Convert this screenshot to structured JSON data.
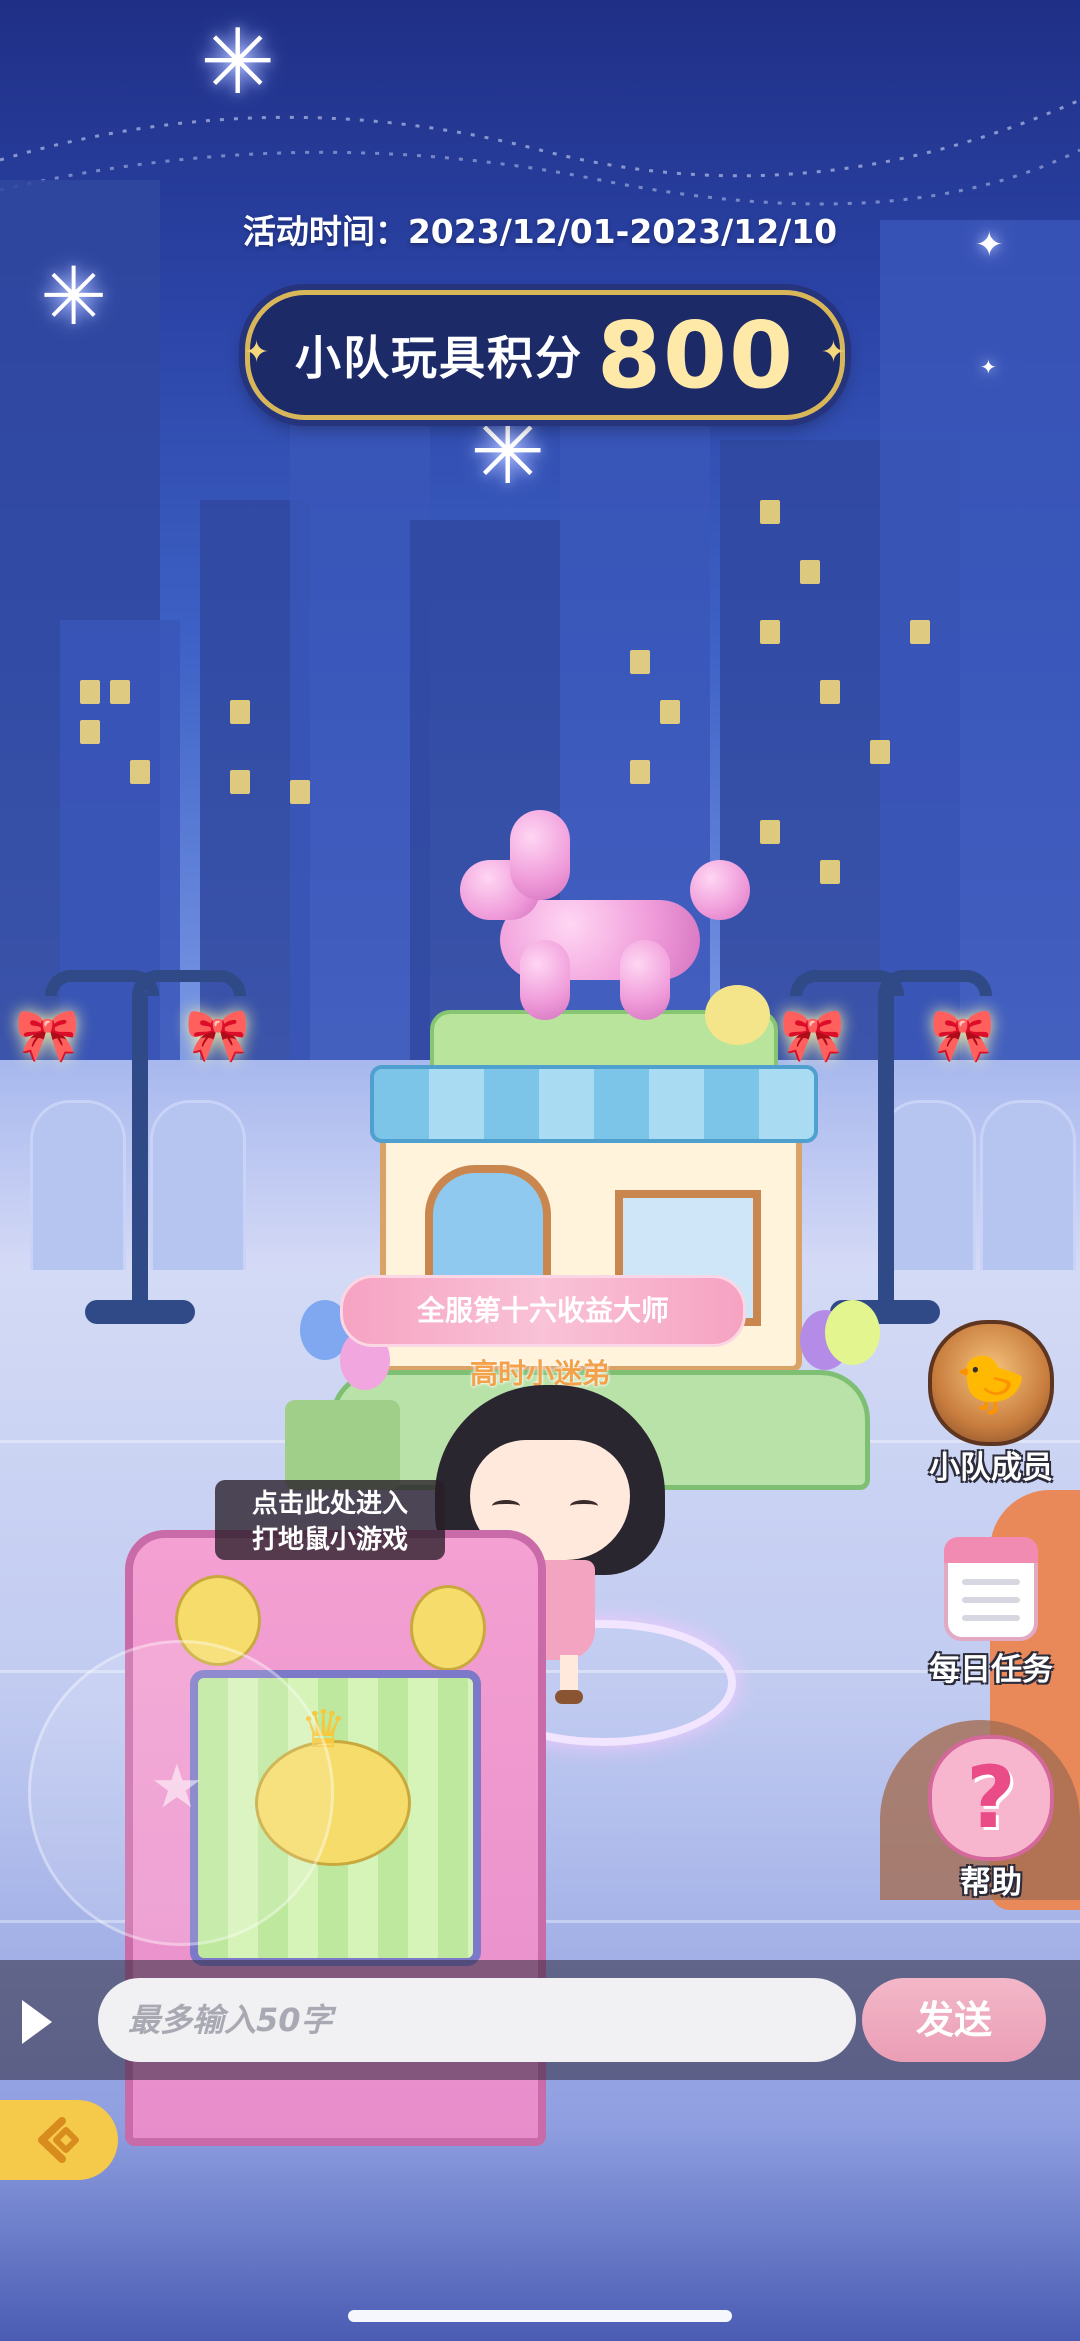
{
  "event": {
    "time_text": "活动时间：2023/12/01-2023/12/10"
  },
  "score": {
    "label": "小队玩具积分",
    "value": "800"
  },
  "player": {
    "title_badge": "全服第十六收益大师",
    "name": "高时小迷弟"
  },
  "minigame": {
    "tooltip_line1": "点击此处进入",
    "tooltip_line2": "打地鼠小游戏"
  },
  "side_menu": {
    "members_label": "小队成员",
    "tasks_label": "每日任务",
    "help_label": "帮助"
  },
  "chat": {
    "placeholder": "最多输入50字",
    "send_label": "发送"
  },
  "colors": {
    "sky_top": "#1f2f86",
    "score_gold": "#ffe9a8",
    "send_pink": "#ea9eb5",
    "back_yellow": "#f5c94a"
  }
}
